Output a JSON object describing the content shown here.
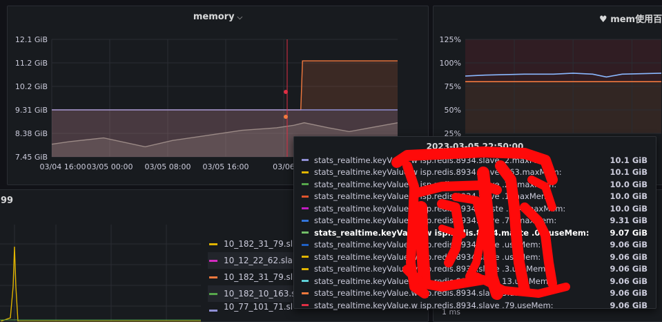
{
  "panels": {
    "memory": {
      "title": "memory"
    },
    "mem_pct": {
      "title": "mem使用百"
    },
    "bottom": {
      "title": "99"
    }
  },
  "legend": [
    {
      "label": "10_182_31_79.sl",
      "color": "#e0b400"
    },
    {
      "label": "10_12_22_62.sla",
      "color": "#d22bbf"
    },
    {
      "label": "10_182_31_79.sl",
      "color": "#f2793e"
    },
    {
      "label": "10_182_10_163.s",
      "color": "#56a64b"
    }
  ],
  "legend_partial": "10_77_101_71.sl",
  "bottom_right_label": "1 ms",
  "tooltip": {
    "time": "2023-03-05 22:50:00",
    "rows": [
      {
        "name": "stats_realtime.keyValue.w  isp.redis.8934.slave  .2.maxMem:",
        "value": "10.1 GiB",
        "color": "#8f8fd4"
      },
      {
        "name": "stats_realtime.keyValue.w  isp.redis.8934.slave  .163.maxMem:",
        "value": "10.1 GiB",
        "color": "#e0b400"
      },
      {
        "name": "stats_realtime.keyValue.w  isp.redis.8934.slave  .23.maxMem:",
        "value": "10.0 GiB",
        "color": "#56a64b"
      },
      {
        "name": "stats_realtime.keyValue.w  isp.redis.8934.slave  .1.maxMem:",
        "value": "10.0 GiB",
        "color": "#e0542d"
      },
      {
        "name": "stats_realtime.keyValue.w  isp.redis.8934.maste  .204.maxMem:",
        "value": "10.0 GiB",
        "color": "#c11cc1"
      },
      {
        "name": "stats_realtime.keyValue.w  isp.redis.8934.slave  .79.maxMem:",
        "value": "9.31 GiB",
        "color": "#3274d9"
      },
      {
        "name": "stats_realtime.keyValue.w  isp.redis.8934.maste  .04.useMem:",
        "value": "9.07 GiB",
        "color": "#73bf69",
        "bold": true
      },
      {
        "name": "stats_realtime.keyValue.w  isp.redis.8934.slave  .useMem:",
        "value": "9.06 GiB",
        "color": "#1f60c4"
      },
      {
        "name": "stats_realtime.keyValue.w  isp.redis.8934.slave  .useMem:",
        "value": "9.06 GiB",
        "color": "#e0b400"
      },
      {
        "name": "stats_realtime.keyValue.w  isp.redis.8934.slave  .3.useMem:",
        "value": "9.06 GiB",
        "color": "#e0b400"
      },
      {
        "name": "stats_realtime.keyValue.w  isp.redis.8934.slave  13.useMem:",
        "value": "9.06 GiB",
        "color": "#5ecfd6"
      },
      {
        "name": "stats_realtime.keyValue.w  isp.redis.8934.slave  3.useMem:",
        "value": "9.06 GiB",
        "color": "#f2793e"
      },
      {
        "name": "stats_realtime.keyValue.w  isp.redis.8934.slave  .79.useMem:",
        "value": "9.06 GiB",
        "color": "#e02f44"
      }
    ]
  },
  "chart_data": [
    {
      "type": "area",
      "title": "memory",
      "y_ticks": [
        "12.1 GiB",
        "11.2 GiB",
        "10.2 GiB",
        "9.31 GiB",
        "8.38 GiB",
        "7.45 GiB"
      ],
      "x_ticks": [
        "03/04 16:00",
        "03/05 00:00",
        "03/05 08:00",
        "03/05 16:00",
        "03/06"
      ],
      "ylim": [
        7.45,
        12.1
      ],
      "series": [
        {
          "color": "#f2793e",
          "x": [
            0,
            0.72,
            0.725,
            1.0
          ],
          "values": [
            9.31,
            9.31,
            11.25,
            11.25
          ]
        },
        {
          "color": "#8f8fd4",
          "x": [
            0,
            0.72,
            0.725,
            1.0
          ],
          "values": [
            9.31,
            9.31,
            9.31,
            9.31
          ]
        },
        {
          "color": "#9b8a86",
          "x": [
            0,
            0.05,
            0.15,
            0.27,
            0.35,
            0.45,
            0.55,
            0.65,
            0.7,
            0.73,
            0.8,
            0.86,
            0.92,
            1.0
          ],
          "values": [
            7.95,
            8.05,
            8.2,
            7.85,
            8.1,
            8.3,
            8.5,
            8.6,
            8.7,
            8.8,
            8.6,
            8.45,
            8.6,
            8.8
          ]
        }
      ]
    },
    {
      "type": "line",
      "title": "mem使用百",
      "y_ticks": [
        "125%",
        "100%",
        "75%",
        "50%",
        "25%"
      ],
      "ylim": [
        25,
        125
      ],
      "series": [
        {
          "color": "#8ab8ff",
          "x": [
            0,
            0.1,
            0.3,
            0.45,
            0.55,
            0.65,
            0.72,
            0.8,
            1.0
          ],
          "values": [
            86,
            87,
            88,
            88,
            89,
            88,
            85,
            88,
            89
          ]
        },
        {
          "color": "#f2793e",
          "x": [
            0,
            1.0
          ],
          "values": [
            80,
            80
          ]
        }
      ]
    }
  ]
}
